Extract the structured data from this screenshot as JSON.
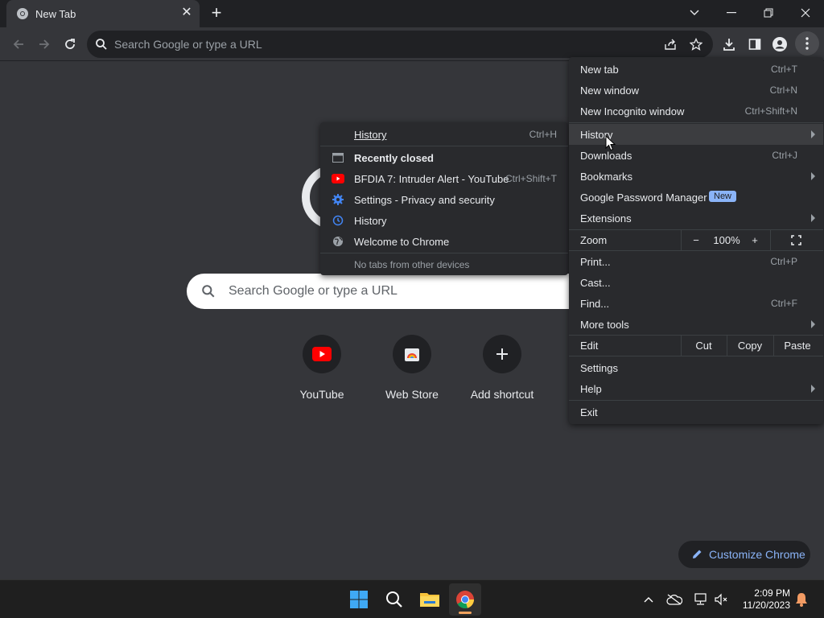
{
  "window": {
    "tab_title": "New Tab",
    "controls": {
      "minimize": "minimize-icon",
      "maximize": "restore-icon",
      "close": "close-icon"
    }
  },
  "toolbar": {
    "omnibox_placeholder": "Search Google or type a URL"
  },
  "ntp": {
    "search_placeholder": "Search Google or type a URL",
    "shortcuts": [
      {
        "label": "YouTube",
        "icon": "youtube-icon"
      },
      {
        "label": "Web Store",
        "icon": "web-store-icon"
      },
      {
        "label": "Add shortcut",
        "icon": "plus-icon"
      }
    ],
    "customize_label": "Customize Chrome"
  },
  "main_menu": {
    "new_tab": {
      "label": "New tab",
      "shortcut": "Ctrl+T"
    },
    "new_window": {
      "label": "New window",
      "shortcut": "Ctrl+N"
    },
    "new_incognito": {
      "label": "New Incognito window",
      "shortcut": "Ctrl+Shift+N"
    },
    "history": {
      "label": "History"
    },
    "downloads": {
      "label": "Downloads",
      "shortcut": "Ctrl+J"
    },
    "bookmarks": {
      "label": "Bookmarks"
    },
    "password_manager": {
      "label": "Google Password Manager",
      "badge": "New"
    },
    "extensions": {
      "label": "Extensions"
    },
    "zoom": {
      "label": "Zoom",
      "minus": "−",
      "level": "100%",
      "plus": "+"
    },
    "print": {
      "label": "Print...",
      "shortcut": "Ctrl+P"
    },
    "cast": {
      "label": "Cast..."
    },
    "find": {
      "label": "Find...",
      "shortcut": "Ctrl+F"
    },
    "more_tools": {
      "label": "More tools"
    },
    "edit": {
      "label": "Edit",
      "cut": "Cut",
      "copy": "Copy",
      "paste": "Paste"
    },
    "settings": {
      "label": "Settings"
    },
    "help": {
      "label": "Help"
    },
    "exit": {
      "label": "Exit"
    }
  },
  "history_menu": {
    "history": {
      "label": "History",
      "shortcut": "Ctrl+H"
    },
    "recently_closed": "Recently closed",
    "items": [
      {
        "label": "BFDIA 7: Intruder Alert - YouTube",
        "shortcut": "Ctrl+Shift+T",
        "icon": "youtube-icon"
      },
      {
        "label": "Settings - Privacy and security",
        "icon": "settings-gear-icon"
      },
      {
        "label": "History",
        "icon": "history-clock-icon"
      },
      {
        "label": "Welcome to Chrome",
        "icon": "globe-icon"
      }
    ],
    "no_tabs": "No tabs from other devices"
  },
  "taskbar": {
    "time": "2:09 PM",
    "date": "11/20/2023"
  },
  "colors": {
    "background": "#35363a",
    "titlebar": "#202124",
    "menu": "#292a2d",
    "accent": "#8ab4f8",
    "youtube_red": "#ff0000"
  }
}
